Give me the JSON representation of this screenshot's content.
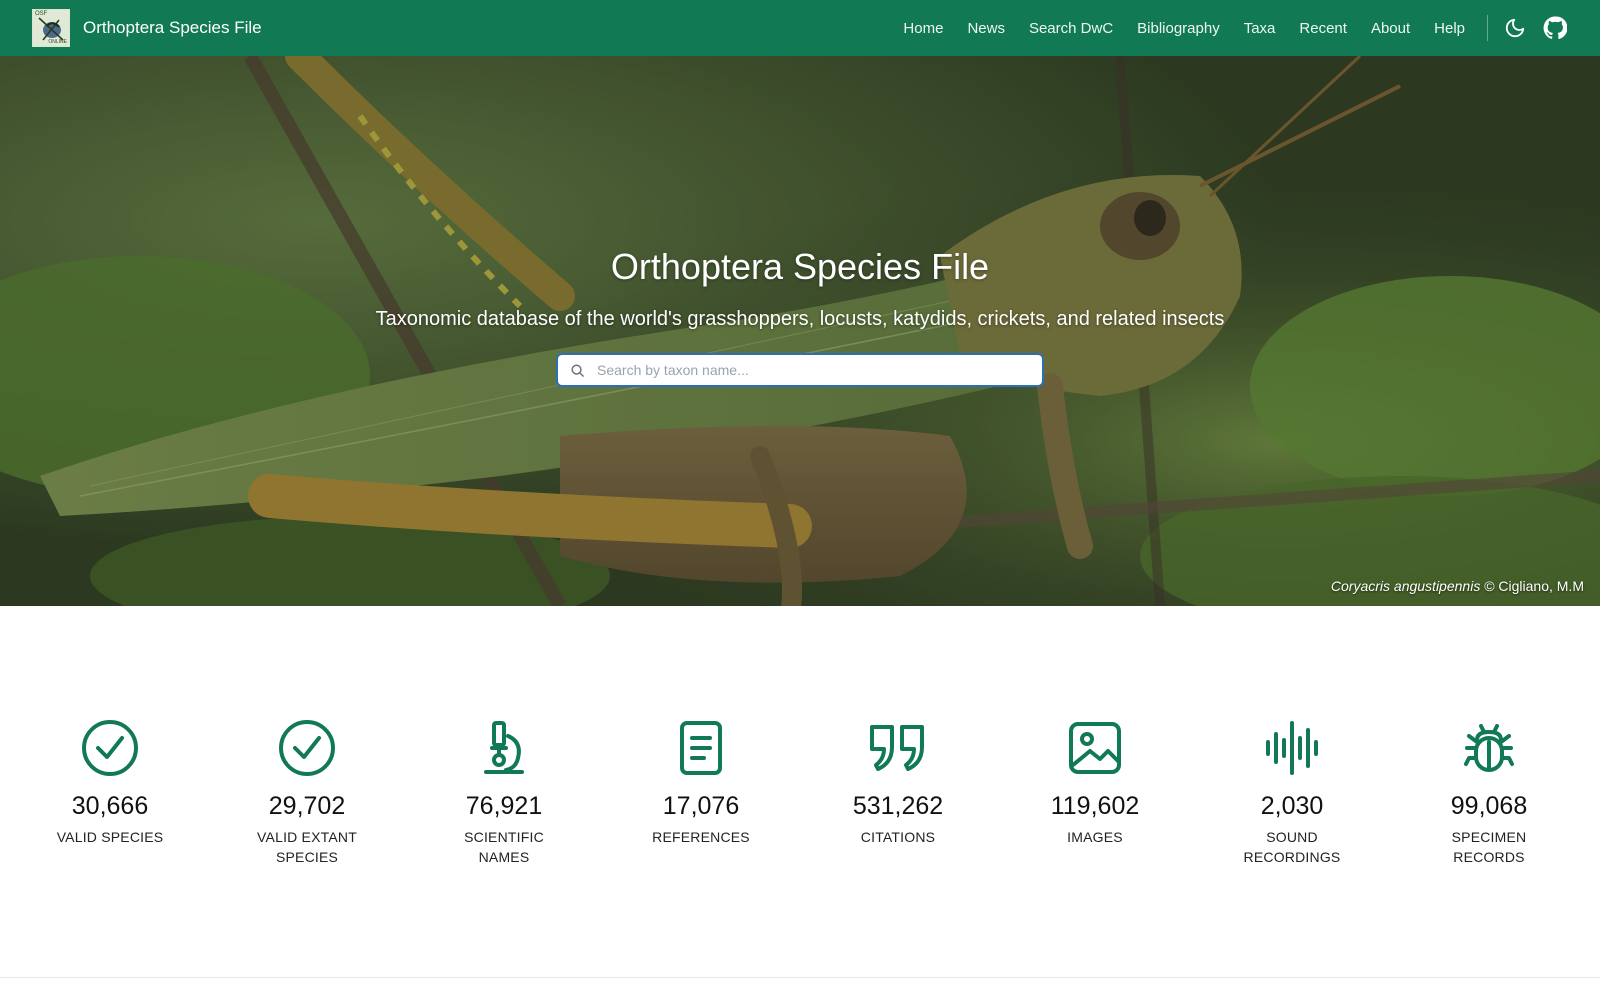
{
  "navbar": {
    "brand": "Orthoptera Species File",
    "logo_text_top": "OSF",
    "logo_text_bottom": "ONLINE",
    "links": [
      "Home",
      "News",
      "Search DwC",
      "Bibliography",
      "Taxa",
      "Recent",
      "About",
      "Help"
    ],
    "icons": [
      "moon-icon",
      "github-icon"
    ],
    "bg_color": "#117a55"
  },
  "hero": {
    "title": "Orthoptera Species File",
    "subtitle": "Taxonomic database of the world's grasshoppers, locusts, katydids, crickets, and related insects",
    "search_placeholder": "Search by taxon name...",
    "credit_species": "Coryacris angustipennis",
    "credit_author": "© Cigliano, M.M"
  },
  "stats": [
    {
      "icon": "check-circle-icon",
      "value": "30,666",
      "label": "VALID SPECIES"
    },
    {
      "icon": "check-circle-icon",
      "value": "29,702",
      "label": "VALID EXTANT SPECIES"
    },
    {
      "icon": "microscope-icon",
      "value": "76,921",
      "label": "SCIENTIFIC NAMES"
    },
    {
      "icon": "document-icon",
      "value": "17,076",
      "label": "REFERENCES"
    },
    {
      "icon": "quote-icon",
      "value": "531,262",
      "label": "CITATIONS"
    },
    {
      "icon": "image-icon",
      "value": "119,602",
      "label": "IMAGES"
    },
    {
      "icon": "soundwave-icon",
      "value": "2,030",
      "label": "SOUND RECORDINGS"
    },
    {
      "icon": "bug-icon",
      "value": "99,068",
      "label": "SPECIMEN RECORDS"
    }
  ],
  "accent_color": "#117a55"
}
